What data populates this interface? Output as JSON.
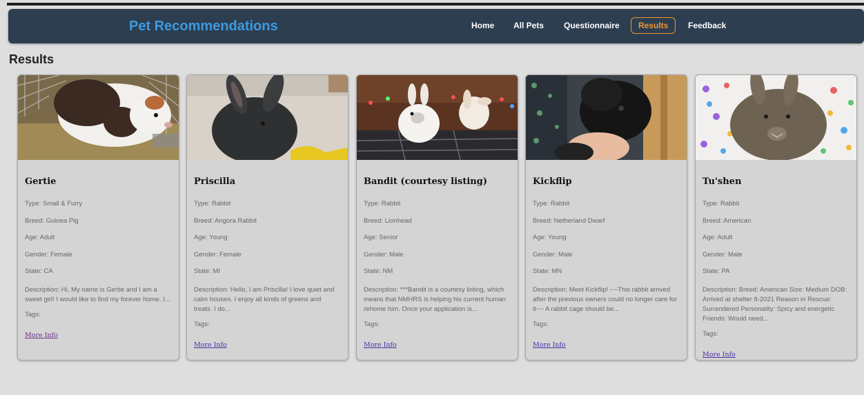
{
  "nav": {
    "brand": "Pet Recommendations",
    "links": [
      {
        "label": "Home",
        "active": false
      },
      {
        "label": "All Pets",
        "active": false
      },
      {
        "label": "Questionnaire",
        "active": false
      },
      {
        "label": "Results",
        "active": true
      },
      {
        "label": "Feedback",
        "active": false
      }
    ]
  },
  "page": {
    "title": "Results"
  },
  "colors": {
    "navbar": "#2d3e50",
    "brand": "#3d9ae0",
    "active_link": "#f0952e",
    "card_bg": "#d4d4d4",
    "page_bg": "#dedede"
  },
  "pets": [
    {
      "name": "Gertie",
      "type": "Type: Small & Furry",
      "breed": "Breed: Guinea Pig",
      "age": "Age: Adult",
      "gender": "Gender: Female",
      "state": "State: CA",
      "description": "Description: Hi, My name is Gertie and I am a sweet girl! I would like to find my forever home. I...",
      "tags": "Tags:",
      "more_info": "More Info",
      "photo_icon": "guinea-pig-photo"
    },
    {
      "name": "Priscilla",
      "type": "Type: Rabbit",
      "breed": "Breed: Angora Rabbit",
      "age": "Age: Young",
      "gender": "Gender: Female",
      "state": "State: MI",
      "description": "Description: Hello, I am Priscilla! I love quiet and calm houses. I enjoy all kinds of greens and treats. I do...",
      "tags": "Tags:",
      "more_info": "More Info",
      "photo_icon": "rabbit-photo"
    },
    {
      "name": "Bandit (courtesy listing)",
      "type": "Type: Rabbit",
      "breed": "Breed: Lionhead",
      "age": "Age: Senior",
      "gender": "Gender: Male",
      "state": "State: NM",
      "description": "Description: ***Bandit is a courtesy listing, which means that NMHRS is helping his current human rehome him. Once your application is...",
      "tags": "Tags:",
      "more_info": "More Info",
      "photo_icon": "rabbit-photo"
    },
    {
      "name": "Kickflip",
      "type": "Type: Rabbit",
      "breed": "Breed: Netherland Dwarf",
      "age": "Age: Young",
      "gender": "Gender: Male",
      "state": "State: MN",
      "description": "Description: Meet Kickflip! ~~This rabbit arrived after the previous owners could no longer care for it~~ A rabbit cage should be...",
      "tags": "Tags:",
      "more_info": "More Info",
      "photo_icon": "rabbit-photo"
    },
    {
      "name": "Tu'shen",
      "type": "Type: Rabbit",
      "breed": "Breed: American",
      "age": "Age: Adult",
      "gender": "Gender: Male",
      "state": "State: PA",
      "description": "Description: Breed: American Size: Medium DOB: Arrived at shelter 8-2021 Reason in Rescue: Surrendered Personality: Spicy and energetic Friends: Would need...",
      "tags": "Tags:",
      "more_info": "More Info",
      "photo_icon": "rabbit-photo"
    }
  ]
}
